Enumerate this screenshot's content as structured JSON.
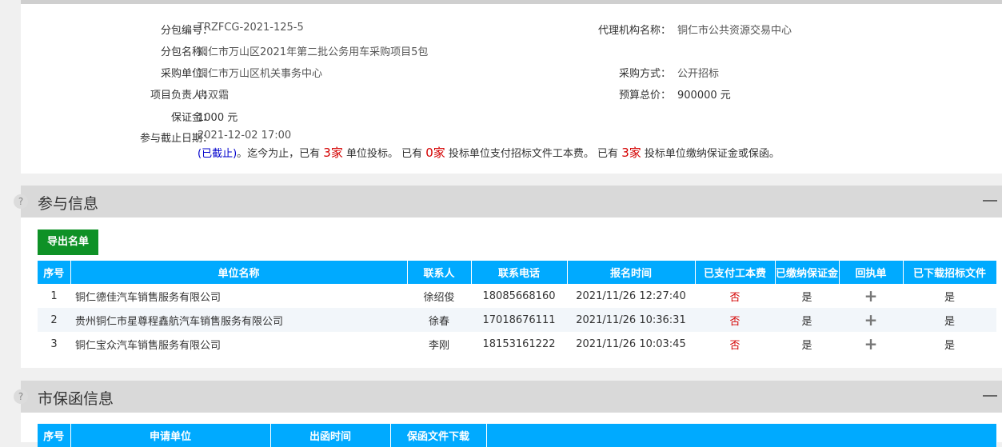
{
  "package": {
    "number_label": "分包编号：",
    "number_value": "TRZFCG-2021-125-5",
    "agency_label": "代理机构名称：",
    "agency_value": "铜仁市公共资源交易中心",
    "name_label": "分包名称：",
    "name_value": "铜仁市万山区2021年第二批公务用车采购项目5包",
    "buyer_label": "采购单位：",
    "buyer_value": "铜仁市万山区机关事务中心",
    "method_label": "采购方式：",
    "method_value": "公开招标",
    "manager_label": "项目负责人：",
    "manager_value": "冉双霜",
    "budget_label": "预算总价：",
    "budget_value": "900000 元",
    "deposit_label": "保证金：",
    "deposit_value": "1000 元",
    "deadline_label": "参与截止日期：",
    "deadline_value": "2021-12-02 17:00",
    "status": {
      "closed": "(已截止)",
      "part1": "。迄今为止，已有 ",
      "bidders_count": "3家",
      "part2": " 单位投标。 已有 ",
      "fee_count": "0家",
      "part3": " 投标单位支付招标文件工本费。 已有 ",
      "deposit_count": "3家",
      "part4": " 投标单位缴纳保证金或保函。"
    }
  },
  "participation": {
    "title": "参与信息",
    "export_label": "导出名单",
    "columns": [
      "序号",
      "单位名称",
      "联系人",
      "联系电话",
      "报名时间",
      "已支付工本费",
      "已缴纳保证金",
      "回执单",
      "已下载招标文件"
    ],
    "rows": [
      {
        "no": "1",
        "name": "铜仁德佳汽车销售服务有限公司",
        "contact": "徐绍俊",
        "phone": "18085668160",
        "time": "2021/11/26 12:27:40",
        "fee_paid": "否",
        "deposit_paid": "是",
        "receipt": "+",
        "downloaded": "是"
      },
      {
        "no": "2",
        "name": "贵州铜仁市星尊程鑫航汽车销售服务有限公司",
        "contact": "徐春",
        "phone": "17018676111",
        "time": "2021/11/26 10:36:31",
        "fee_paid": "否",
        "deposit_paid": "是",
        "receipt": "+",
        "downloaded": "是"
      },
      {
        "no": "3",
        "name": "铜仁宝众汽车销售服务有限公司",
        "contact": "李刚",
        "phone": "18153161222",
        "time": "2021/11/26 10:03:45",
        "fee_paid": "否",
        "deposit_paid": "是",
        "receipt": "+",
        "downloaded": "是"
      }
    ]
  },
  "guarantee": {
    "title": "市保函信息",
    "columns": [
      "序号",
      "申请单位",
      "出函时间",
      "保函文件下载",
      ""
    ]
  },
  "side_icons": [
    "?",
    "?"
  ],
  "colors": {
    "header_blue": "#00aaff",
    "export_green": "#0e9126",
    "highlight_red": "#d40000",
    "link_blue": "#0000cc"
  }
}
